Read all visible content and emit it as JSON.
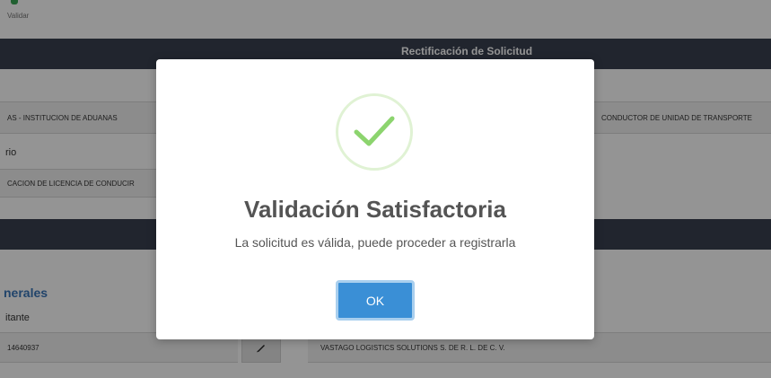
{
  "background": {
    "logo_text": "Validar",
    "header_band_title": "Rectificación de Solicitud",
    "institution_field": "AS - INSTITUCION DE ADUANAS",
    "procedure_field": "CONDUCTOR DE UNIDAD DE TRANSPORTE",
    "secondary_label": "rio",
    "license_field": "CACION DE LICENCIA DE CONDUCIR",
    "section_title": "nerales",
    "applicant_label": "itante",
    "applicant_id": "14640937",
    "company_name": "VASTAGO LOGISTICS SOLUTIONS S. DE R. L. DE C. V."
  },
  "modal": {
    "title": "Validación Satisfactoria",
    "message": "La solicitud es válida, puede proceder a registrarla",
    "ok_label": "OK"
  },
  "colors": {
    "band": "#3a4050",
    "section_title": "#3a76b8",
    "success_check": "#8cd46e",
    "ok_button": "#3a8fd6"
  },
  "icons": {
    "success": "check-circle-icon",
    "edit": "pencil-icon"
  }
}
